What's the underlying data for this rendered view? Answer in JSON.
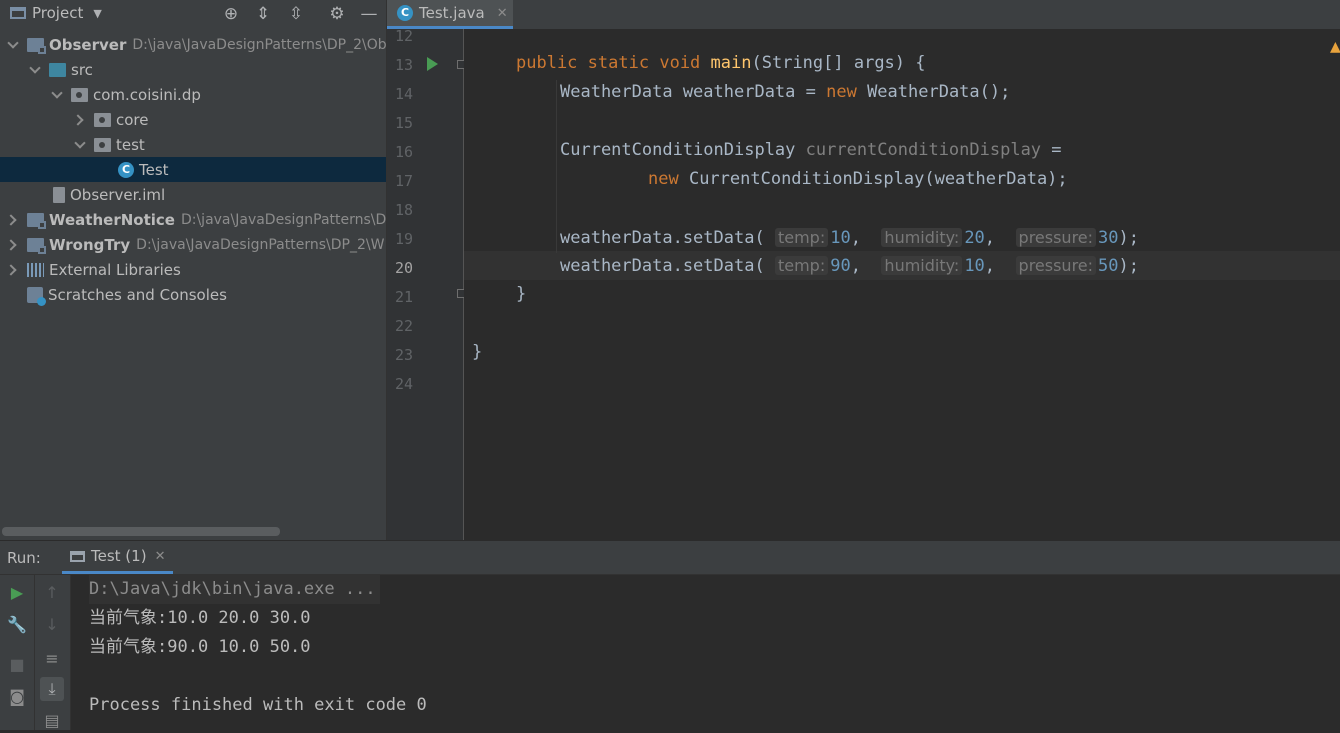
{
  "project_panel": {
    "title": "Project",
    "toolbar_icons": [
      "crosshair-icon",
      "expand-all-icon",
      "collapse-all-icon",
      "gear-icon",
      "minimize-icon"
    ],
    "tree": [
      {
        "label": "Observer",
        "path": "D:\\java\\JavaDesignPatterns\\DP_2\\Ob",
        "icon": "module-icon",
        "expanded": true
      },
      {
        "label": "src",
        "icon": "source-folder-icon",
        "expanded": true
      },
      {
        "label": "com.coisini.dp",
        "icon": "package-icon",
        "expanded": true
      },
      {
        "label": "core",
        "icon": "package-icon",
        "expanded": false
      },
      {
        "label": "test",
        "icon": "package-icon",
        "expanded": true
      },
      {
        "label": "Test",
        "icon": "java-class-icon",
        "selected": true
      },
      {
        "label": "Observer.iml",
        "icon": "iml-file-icon"
      },
      {
        "label": "WeatherNotice",
        "path": "D:\\java\\JavaDesignPatterns\\D",
        "icon": "module-icon",
        "expanded": false
      },
      {
        "label": "WrongTry",
        "path": "D:\\java\\JavaDesignPatterns\\DP_2\\W",
        "icon": "module-icon",
        "expanded": false
      },
      {
        "label": "External Libraries",
        "icon": "libraries-icon",
        "expanded": false
      },
      {
        "label": "Scratches and Consoles",
        "icon": "scratches-icon"
      }
    ]
  },
  "editor": {
    "tab_label": "Test.java",
    "line_numbers": [
      "12",
      "13",
      "14",
      "15",
      "16",
      "17",
      "18",
      "19",
      "20",
      "21",
      "22",
      "23",
      "24"
    ],
    "current_line": "20",
    "code": {
      "l13_kw1": "public",
      "l13_kw2": "static",
      "l13_kw3": "void",
      "l13_fn": "main",
      "l13_rest": "(String[] args) {",
      "l14_a": "WeatherData weatherData = ",
      "l14_kw": "new",
      "l14_b": " WeatherData();",
      "l16_a": "CurrentConditionDisplay ",
      "l16_var": "currentConditionDisplay",
      "l16_b": " =",
      "l17_kw": "new",
      "l17_b": " CurrentConditionDisplay(weatherData);",
      "call": "weatherData.setData(",
      "hint_temp": "temp:",
      "hint_humidity": "humidity:",
      "hint_pressure": "pressure:",
      "l19_temp": "10",
      "l19_humidity": "20",
      "l19_pressure": "30",
      "l20_temp": "90",
      "l20_humidity": "10",
      "l20_pressure": "50",
      "comma": ",",
      "close": ");",
      "l21": "}",
      "l23": "}"
    }
  },
  "run_panel": {
    "label": "Run:",
    "tab_label": "Test (1)",
    "console": [
      "D:\\Java\\jdk\\bin\\java.exe ...",
      "当前气象:10.0 20.0 30.0",
      "当前气象:90.0 10.0 50.0",
      "",
      "Process finished with exit code 0"
    ]
  },
  "colors": {
    "keyword": "#cc7832",
    "function": "#ffc66d",
    "number": "#6897bb",
    "text": "#a9b7c6",
    "run_green": "#499c54",
    "selection": "#0d293e"
  }
}
